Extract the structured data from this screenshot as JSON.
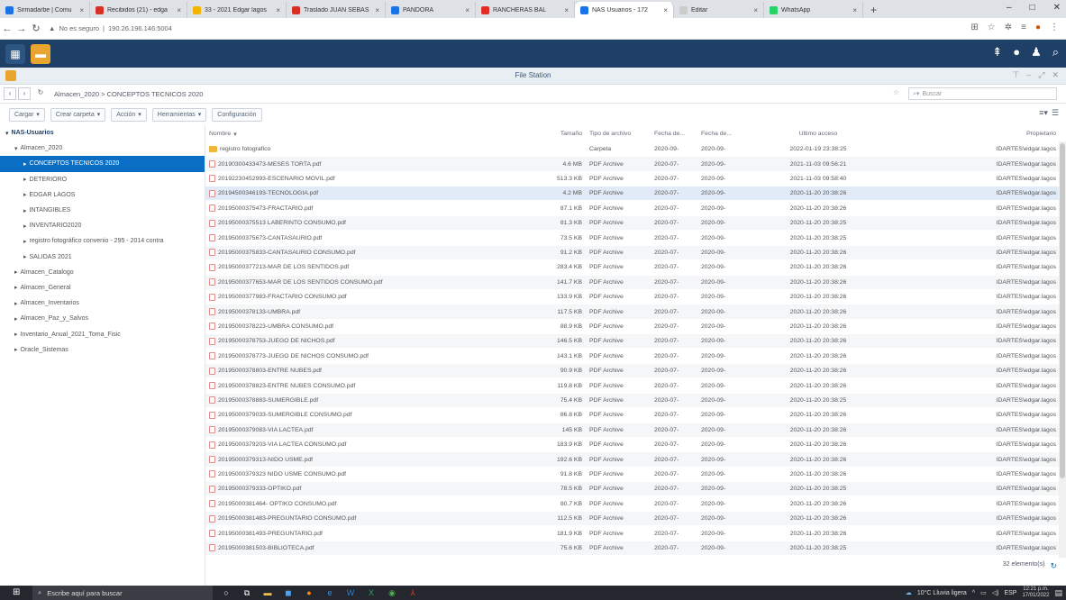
{
  "browser": {
    "tabs": [
      {
        "title": "Sirmadarbe | Comu",
        "color": "#1a73e8"
      },
      {
        "title": "Recibidos (21) - edga",
        "color": "#d93025"
      },
      {
        "title": "33 - 2021 Edgar lagos",
        "color": "#f4b400"
      },
      {
        "title": "Traslado JUAN SEBAS",
        "color": "#d93025"
      },
      {
        "title": "PANDORA",
        "color": "#1a73e8"
      },
      {
        "title": "RANCHERAS BAL",
        "color": "#e52d27"
      },
      {
        "title": "NAS Usuarios - 172",
        "color": "#1a73e8"
      },
      {
        "title": "Editar",
        "color": "#cccccc"
      },
      {
        "title": "WhatsApp",
        "color": "#25d366"
      }
    ],
    "address": {
      "security": "No es seguro",
      "host": "190.26.196.146:5004"
    },
    "window_controls": [
      "–",
      "□",
      "✕"
    ]
  },
  "app": {
    "title": "File Station"
  },
  "path": {
    "segments": [
      "Almacen_2020",
      ">",
      "CONCEPTOS TECNICOS 2020"
    ],
    "search_placeholder": "Buscar"
  },
  "toolbar": {
    "upload": "Cargar",
    "create_folder": "Crear carpeta",
    "action": "Acción",
    "tools": "Herramientas",
    "settings": "Configuración"
  },
  "tree": [
    {
      "label": "NAS-Usuarios",
      "level": 0,
      "toggle": "▾",
      "type": "root"
    },
    {
      "label": "Almacen_2020",
      "level": 1,
      "toggle": "▾",
      "type": "normal"
    },
    {
      "label": "CONCEPTOS TECNICOS 2020",
      "level": 2,
      "toggle": "▸",
      "type": "selected"
    },
    {
      "label": "DETERIORO",
      "level": 2,
      "toggle": "▸",
      "type": "normal"
    },
    {
      "label": "EDGAR LAGOS",
      "level": 2,
      "toggle": "▸",
      "type": "normal"
    },
    {
      "label": "INTANGIBLES",
      "level": 2,
      "toggle": "▸",
      "type": "normal"
    },
    {
      "label": "INVENTARIO2020",
      "level": 2,
      "toggle": "▸",
      "type": "normal"
    },
    {
      "label": "registro fotográfico convenio - 295 - 2014 contra",
      "level": 2,
      "toggle": "▸",
      "type": "normal"
    },
    {
      "label": "SALIDAS 2021",
      "level": 2,
      "toggle": "▸",
      "type": "normal"
    },
    {
      "label": "Almacen_Catalogo",
      "level": 1,
      "toggle": "▸",
      "type": "normal"
    },
    {
      "label": "Almacen_General",
      "level": 1,
      "toggle": "▸",
      "type": "normal"
    },
    {
      "label": "Almacen_Inventarios",
      "level": 1,
      "toggle": "▸",
      "type": "normal"
    },
    {
      "label": "Almacen_Paz_y_Salvos",
      "level": 1,
      "toggle": "▸",
      "type": "normal"
    },
    {
      "label": "Inventario_Anual_2021_Toma_Fisic",
      "level": 1,
      "toggle": "▸",
      "type": "normal"
    },
    {
      "label": "Oracle_Sistemas",
      "level": 1,
      "toggle": "▸",
      "type": "normal"
    }
  ],
  "table": {
    "headers": [
      "Nombre",
      "Tamaño",
      "Tipo de archivo",
      "Fecha de...",
      "Fecha de...",
      "Último acceso",
      "Propietario"
    ],
    "rows": [
      {
        "name": "registro fotografico",
        "size": "",
        "type": "Carpeta",
        "d1": "2020-09-",
        "d2": "2020-09-",
        "access": "2022-01-19 23:38:25",
        "owner": "IDARTES\\edgar.lagos",
        "folder": true
      },
      {
        "name": "20190300433473-MESES TORTA.pdf",
        "size": "4.6 MB",
        "type": "PDF Archive",
        "d1": "2020-07-",
        "d2": "2020-09-",
        "access": "2021-11-03 09:56:21",
        "owner": "IDARTES\\edgar.lagos"
      },
      {
        "name": "20192230452993-ESCENARIO MOVIL.pdf",
        "size": "513.3 KB",
        "type": "PDF Archive",
        "d1": "2020-07-",
        "d2": "2020-09-",
        "access": "2021-11-03 09:58:40",
        "owner": "IDARTES\\edgar.lagos"
      },
      {
        "name": "20194500346193-TECNOLOGIA.pdf",
        "size": "4.2 MB",
        "type": "PDF Archive",
        "d1": "2020-07-",
        "d2": "2020-09-",
        "access": "2020-11-20 20:38:26",
        "owner": "IDARTES\\edgar.lagos",
        "highlight": true
      },
      {
        "name": "20195000375473-FRACTARIO.pdf",
        "size": "87.1 KB",
        "type": "PDF Archive",
        "d1": "2020-07-",
        "d2": "2020-09-",
        "access": "2020-11-20 20:38:26",
        "owner": "IDARTES\\edgar.lagos"
      },
      {
        "name": "20195000375513 LABERINTO CONSUMO.pdf",
        "size": "81.3 KB",
        "type": "PDF Archive",
        "d1": "2020-07-",
        "d2": "2020-09-",
        "access": "2020-11-20 20:38:25",
        "owner": "IDARTES\\edgar.lagos"
      },
      {
        "name": "20195000375673-CANTASAURIO.pdf",
        "size": "73.5 KB",
        "type": "PDF Archive",
        "d1": "2020-07-",
        "d2": "2020-09-",
        "access": "2020-11-20 20:38:25",
        "owner": "IDARTES\\edgar.lagos"
      },
      {
        "name": "20195000375833-CANTASAURIO CONSUMO.pdf",
        "size": "91.2 KB",
        "type": "PDF Archive",
        "d1": "2020-07-",
        "d2": "2020-09-",
        "access": "2020-11-20 20:38:26",
        "owner": "IDARTES\\edgar.lagos"
      },
      {
        "name": "20195000377213-MAR DE LOS SENTIDOS.pdf",
        "size": "283.4 KB",
        "type": "PDF Archive",
        "d1": "2020-07-",
        "d2": "2020-09-",
        "access": "2020-11-20 20:38:26",
        "owner": "IDARTES\\edgar.lagos"
      },
      {
        "name": "20195000377653-MAR DE LOS SENTIDOS CONSUMO.pdf",
        "size": "141.7 KB",
        "type": "PDF Archive",
        "d1": "2020-07-",
        "d2": "2020-09-",
        "access": "2020-11-20 20:38:26",
        "owner": "IDARTES\\edgar.lagos"
      },
      {
        "name": "20195000377983-FRACTARIO CONSUMO.pdf",
        "size": "133.9 KB",
        "type": "PDF Archive",
        "d1": "2020-07-",
        "d2": "2020-09-",
        "access": "2020-11-20 20:38:26",
        "owner": "IDARTES\\edgar.lagos"
      },
      {
        "name": "20195000378133-UMBRA.pdf",
        "size": "117.5 KB",
        "type": "PDF Archive",
        "d1": "2020-07-",
        "d2": "2020-09-",
        "access": "2020-11-20 20:38:26",
        "owner": "IDARTES\\edgar.lagos"
      },
      {
        "name": "20195000378223-UMBRA CONSUMO.pdf",
        "size": "88.9 KB",
        "type": "PDF Archive",
        "d1": "2020-07-",
        "d2": "2020-09-",
        "access": "2020-11-20 20:38:26",
        "owner": "IDARTES\\edgar.lagos"
      },
      {
        "name": "20195000378753-JUEGO DE NICHOS.pdf",
        "size": "146.5 KB",
        "type": "PDF Archive",
        "d1": "2020-07-",
        "d2": "2020-09-",
        "access": "2020-11-20 20:38:26",
        "owner": "IDARTES\\edgar.lagos"
      },
      {
        "name": "20195000378773-JUEGO DE NICHOS CONSUMO.pdf",
        "size": "143.1 KB",
        "type": "PDF Archive",
        "d1": "2020-07-",
        "d2": "2020-09-",
        "access": "2020-11-20 20:38:26",
        "owner": "IDARTES\\edgar.lagos"
      },
      {
        "name": "20195000378803-ENTRE NUBES.pdf",
        "size": "90.9 KB",
        "type": "PDF Archive",
        "d1": "2020-07-",
        "d2": "2020-09-",
        "access": "2020-11-20 20:38:26",
        "owner": "IDARTES\\edgar.lagos"
      },
      {
        "name": "20195000378823-ENTRE NUBES CONSUMO.pdf",
        "size": "119.8 KB",
        "type": "PDF Archive",
        "d1": "2020-07-",
        "d2": "2020-09-",
        "access": "2020-11-20 20:38:26",
        "owner": "IDARTES\\edgar.lagos"
      },
      {
        "name": "20195000378883-SUMERGIBLE.pdf",
        "size": "75.4 KB",
        "type": "PDF Archive",
        "d1": "2020-07-",
        "d2": "2020-09-",
        "access": "2020-11-20 20:38:25",
        "owner": "IDARTES\\edgar.lagos"
      },
      {
        "name": "20195000379033-SUMERGIBLE CONSUMO.pdf",
        "size": "86.8 KB",
        "type": "PDF Archive",
        "d1": "2020-07-",
        "d2": "2020-09-",
        "access": "2020-11-20 20:38:26",
        "owner": "IDARTES\\edgar.lagos"
      },
      {
        "name": "20195000379083-VIA LACTEA.pdf",
        "size": "145 KB",
        "type": "PDF Archive",
        "d1": "2020-07-",
        "d2": "2020-09-",
        "access": "2020-11-20 20:38:26",
        "owner": "IDARTES\\edgar.lagos"
      },
      {
        "name": "20195000379203-VIA LACTEA CONSUMO.pdf",
        "size": "183.9 KB",
        "type": "PDF Archive",
        "d1": "2020-07-",
        "d2": "2020-09-",
        "access": "2020-11-20 20:38:26",
        "owner": "IDARTES\\edgar.lagos"
      },
      {
        "name": "20195000379313-NIDO USME.pdf",
        "size": "192.6 KB",
        "type": "PDF Archive",
        "d1": "2020-07-",
        "d2": "2020-09-",
        "access": "2020-11-20 20:38:26",
        "owner": "IDARTES\\edgar.lagos"
      },
      {
        "name": "20195000379323 NIDO USME CONSUMO.pdf",
        "size": "91.8 KB",
        "type": "PDF Archive",
        "d1": "2020-07-",
        "d2": "2020-09-",
        "access": "2020-11-20 20:38:26",
        "owner": "IDARTES\\edgar.lagos"
      },
      {
        "name": "20195000379333-OPTIKO.pdf",
        "size": "78.5 KB",
        "type": "PDF Archive",
        "d1": "2020-07-",
        "d2": "2020-09-",
        "access": "2020-11-20 20:38:25",
        "owner": "IDARTES\\edgar.lagos"
      },
      {
        "name": "20195000381464- OPTIKO CONSUMO.pdf",
        "size": "80.7 KB",
        "type": "PDF Archive",
        "d1": "2020-07-",
        "d2": "2020-09-",
        "access": "2020-11-20 20:38:26",
        "owner": "IDARTES\\edgar.lagos"
      },
      {
        "name": "20195000381483-PREGUNTARIO CONSUMO.pdf",
        "size": "112.5 KB",
        "type": "PDF Archive",
        "d1": "2020-07-",
        "d2": "2020-09-",
        "access": "2020-11-20 20:38:26",
        "owner": "IDARTES\\edgar.lagos"
      },
      {
        "name": "20195000381493-PREGUNTARIO.pdf",
        "size": "181.9 KB",
        "type": "PDF Archive",
        "d1": "2020-07-",
        "d2": "2020-09-",
        "access": "2020-11-20 20:38:26",
        "owner": "IDARTES\\edgar.lagos"
      },
      {
        "name": "20195000381503-BIBLIOTECA.pdf",
        "size": "75.6 KB",
        "type": "PDF Archive",
        "d1": "2020-07-",
        "d2": "2020-09-",
        "access": "2020-11-20 20:38:25",
        "owner": "IDARTES\\edgar.lagos"
      }
    ],
    "item_count": "32 elemento(s)"
  },
  "taskbar": {
    "search_placeholder": "Escribe aquí para buscar",
    "weather": "10°C Lluvia ligera",
    "lang": "ESP",
    "time": "12:21 p.m.",
    "date": "17/01/2022"
  }
}
